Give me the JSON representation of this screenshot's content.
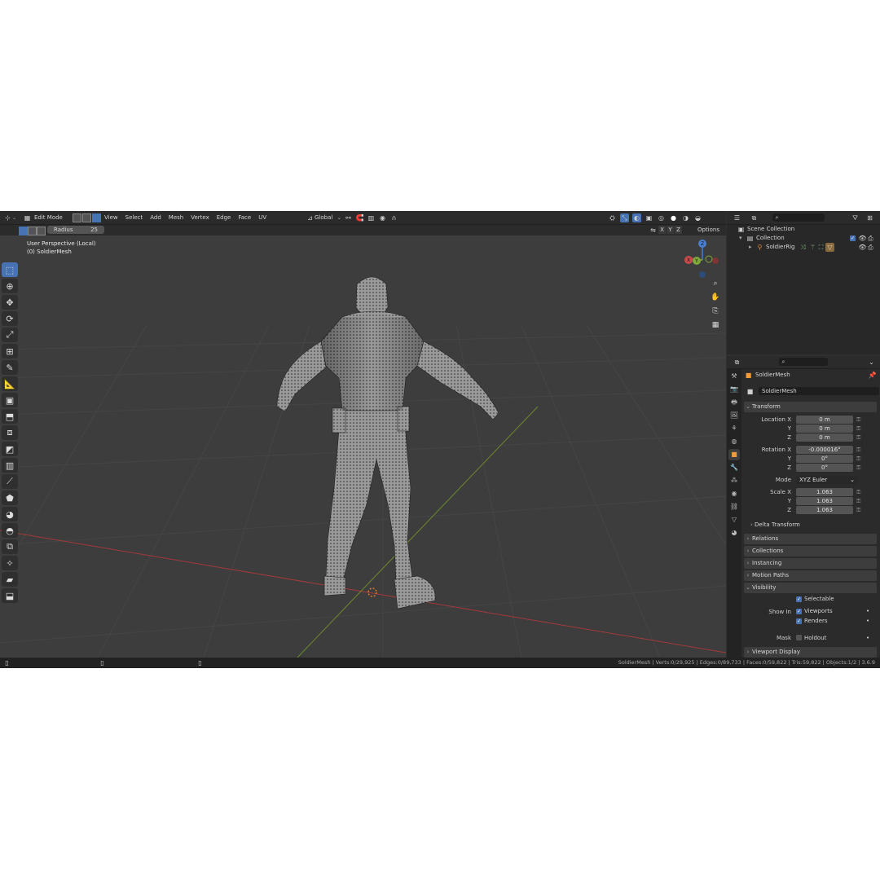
{
  "header": {
    "mode": "Edit Mode",
    "menus": [
      "View",
      "Select",
      "Add",
      "Mesh",
      "Vertex",
      "Edge",
      "Face",
      "UV"
    ],
    "orientation": "Global"
  },
  "tool_settings": {
    "radius_label": "Radius",
    "radius_value": "25",
    "axes": [
      "X",
      "Y",
      "Z"
    ],
    "options": "Options"
  },
  "viewport": {
    "perspective": "User Perspective (Local)",
    "object": "(0) SoldierMesh"
  },
  "gizmo": {
    "z": "Z",
    "y": "Y",
    "x": "X"
  },
  "outliner": {
    "scene_collection": "Scene Collection",
    "collection": "Collection",
    "rig": "SoldierRig"
  },
  "properties": {
    "object_name": "SoldierMesh",
    "data_name": "SoldierMesh",
    "transform": {
      "header": "Transform",
      "location_label": "Location X",
      "location": [
        "0 m",
        "0 m",
        "0 m"
      ],
      "rotation_label": "Rotation X",
      "rotation": [
        "-0.000016°",
        "0°",
        "0°"
      ],
      "mode_label": "Mode",
      "mode": "XYZ Euler",
      "scale_label": "Scale X",
      "scale": [
        "1.063",
        "1.063",
        "1.063"
      ],
      "y_label": "Y",
      "z_label": "Z",
      "delta": "Delta Transform"
    },
    "panels": [
      "Relations",
      "Collections",
      "Instancing",
      "Motion Paths"
    ],
    "visibility": {
      "header": "Visibility",
      "selectable": "Selectable",
      "show_in": "Show In",
      "viewports": "Viewports",
      "renders": "Renders",
      "mask": "Mask",
      "holdout": "Holdout"
    },
    "viewport_display": "Viewport Display"
  },
  "status": "SoldierMesh | Verts:0/29,925 | Edges:0/89,733 | Faces:0/59,822 | Tris:59,822 | Objects:1/2 | 3.6.9",
  "colors": {
    "accent": "#4772b3",
    "x_axis": "#c84b4b",
    "y_axis": "#7fa83a",
    "z_axis": "#4a7fd0"
  }
}
